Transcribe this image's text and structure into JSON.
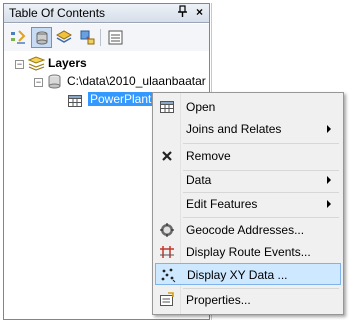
{
  "toc": {
    "title": "Table Of Contents",
    "pin_glyph": "↑",
    "close_glyph": "×",
    "toolbar_icons": [
      "list-by-drawing-order-icon",
      "list-by-source-icon",
      "list-by-visibility-icon",
      "list-by-selection-icon",
      "options-icon"
    ],
    "tree": {
      "root_label": "Layers",
      "root_expander": "−",
      "source_label": "C:\\data\\2010_ulaanbaatar",
      "source_expander": "−",
      "layer_label": "PowerPlant"
    }
  },
  "context_menu": {
    "items": [
      {
        "label": "Open",
        "icon": "table-icon",
        "submenu": false
      },
      {
        "label": "Joins and Relates",
        "icon": "",
        "submenu": true
      },
      {
        "label": "Remove",
        "icon": "remove-x-icon",
        "submenu": false
      },
      {
        "label": "Data",
        "icon": "",
        "submenu": true
      },
      {
        "label": "Edit Features",
        "icon": "",
        "submenu": true
      },
      {
        "label": "Geocode Addresses...",
        "icon": "geocode-icon",
        "submenu": false
      },
      {
        "label": "Display Route Events...",
        "icon": "route-events-icon",
        "submenu": false
      },
      {
        "label": "Display XY Data ...",
        "icon": "xy-data-icon",
        "submenu": false,
        "hovered": true
      },
      {
        "label": "Properties...",
        "icon": "properties-icon",
        "submenu": false
      }
    ]
  },
  "colors": {
    "selection": "#3399ff",
    "menu_hover": "#cde8ff",
    "menu_hover_border": "#7eb4ea"
  }
}
